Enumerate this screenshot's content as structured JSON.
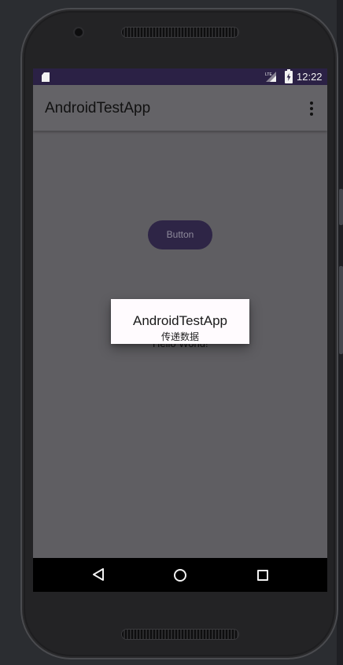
{
  "status_bar": {
    "time": "12:22",
    "sd_icon": "sd-card-icon",
    "network_icon": "lte-signal-icon",
    "battery_icon": "battery-charging-icon"
  },
  "app_bar": {
    "title": "AndroidTestApp",
    "menu_icon": "more-vert-icon"
  },
  "content": {
    "button_label": "Button",
    "hello_text": "Hello World!"
  },
  "dialog": {
    "title": "AndroidTestApp",
    "message": "传递数据"
  },
  "nav_bar": {
    "back_icon": "back-triangle-icon",
    "home_icon": "home-circle-icon",
    "recents_icon": "recents-square-icon"
  },
  "colors": {
    "status_bar": "#2b2145",
    "app_bar_dimmed": "#646367",
    "screen_dimmed": "#5f5e62",
    "button_bg": "#2e2546",
    "dialog_bg": "#fffbfe",
    "nav_bar": "#000000"
  }
}
